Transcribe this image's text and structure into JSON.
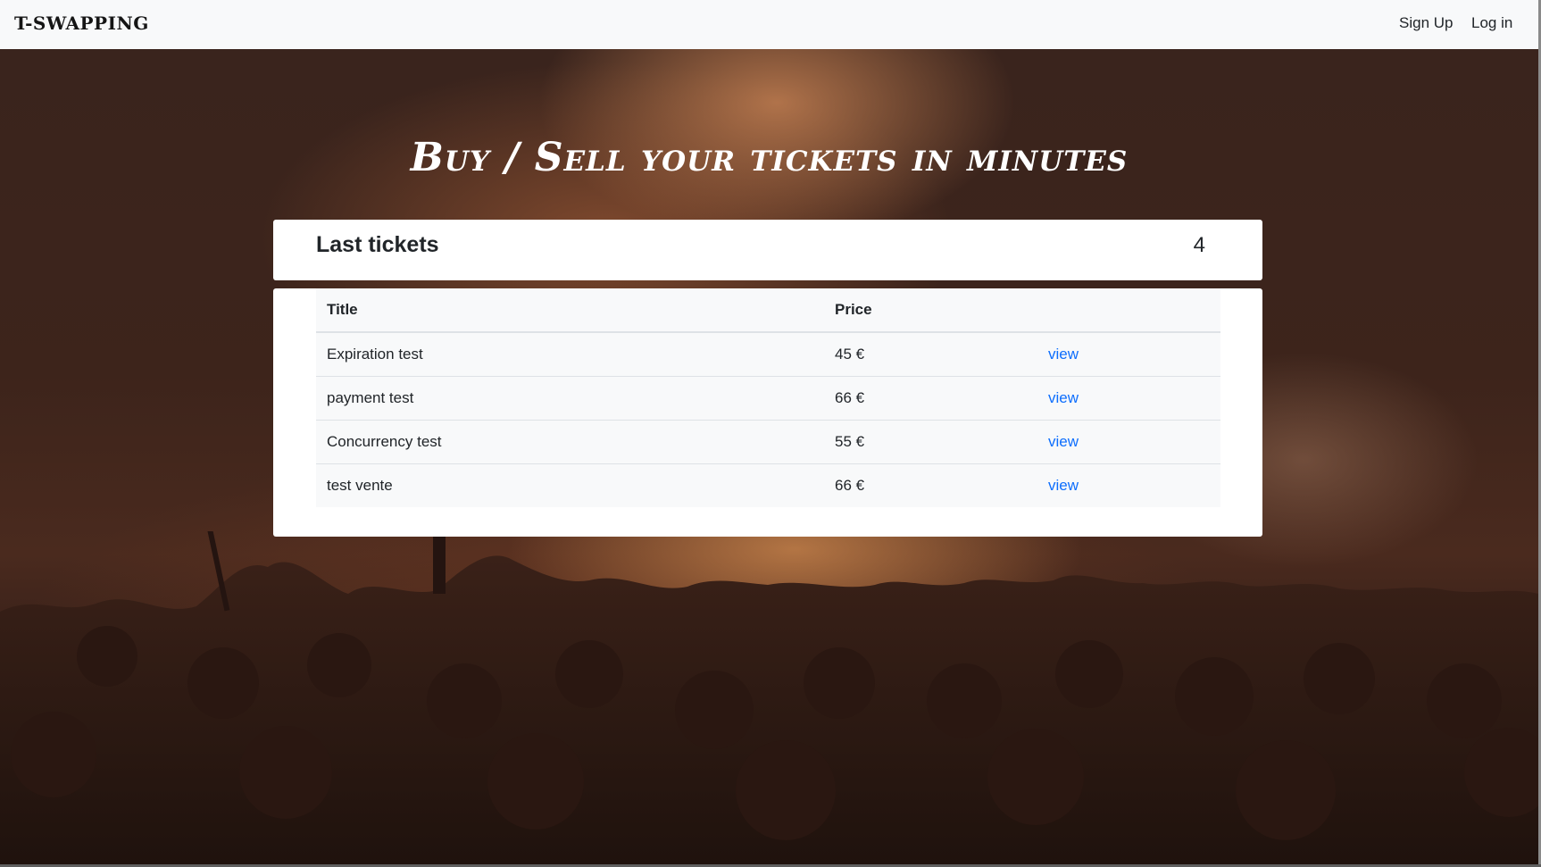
{
  "navbar": {
    "brand": "T-SWAPPING",
    "links": [
      "Sign Up",
      "Log in"
    ]
  },
  "hero": {
    "title": "Buy / Sell your tickets in minutes"
  },
  "tickets_card": {
    "title": "Last tickets",
    "count": "4",
    "columns": [
      "Title",
      "Price",
      ""
    ],
    "rows": [
      {
        "title": "Expiration test",
        "price": "45 €",
        "action": "view"
      },
      {
        "title": "payment test",
        "price": "66 €",
        "action": "view"
      },
      {
        "title": "Concurrency test",
        "price": "55 €",
        "action": "view"
      },
      {
        "title": "test vente",
        "price": "66 €",
        "action": "view"
      }
    ]
  },
  "colors": {
    "navbar_bg": "#f8f9fa",
    "link_blue": "#0d6efd",
    "card_bg": "#ffffff"
  }
}
